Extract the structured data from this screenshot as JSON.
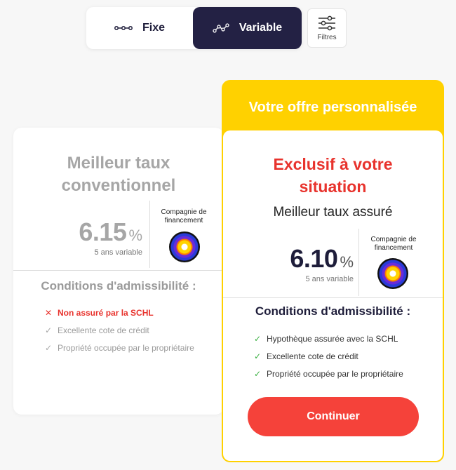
{
  "toggle": {
    "fixed_label": "Fixe",
    "variable_label": "Variable",
    "selected": "Variable"
  },
  "filters": {
    "label": "Filtres"
  },
  "conventional": {
    "title_line1": "Meilleur taux",
    "title_line2": "conventionnel",
    "rate": "6.15",
    "percent": "%",
    "term": "5 ans variable",
    "lender_line1": "Compagnie de",
    "lender_line2": "financement",
    "conditions_title": "Conditions d'admissibilité :",
    "conditions": [
      {
        "text": "Non assuré par la SCHL",
        "status": "no"
      },
      {
        "text": "Excellente cote de crédit",
        "status": "yes"
      },
      {
        "text": "Propriété occupée par le propriétaire",
        "status": "yes"
      }
    ]
  },
  "personalized": {
    "banner": "Votre offre personnalisée",
    "headline_line1": "Exclusif à votre",
    "headline_line2": "situation",
    "subtitle": "Meilleur taux assuré",
    "rate": "6.10",
    "percent": "%",
    "term": "5 ans variable",
    "lender_line1": "Compagnie de",
    "lender_line2": "financement",
    "conditions_title": "Conditions d'admissibilité :",
    "conditions": [
      {
        "text": "Hypothèque assurée avec la SCHL",
        "status": "yes"
      },
      {
        "text": "Excellente cote de crédit",
        "status": "yes"
      },
      {
        "text": "Propriété occupée par le propriétaire",
        "status": "yes"
      }
    ],
    "cta_label": "Continuer"
  },
  "colors": {
    "navy": "#232144",
    "accent_red": "#f5423a",
    "banner_yellow": "#ffd100",
    "check_green": "#3cb043",
    "muted_grey": "#a6a6a6"
  },
  "icons": {
    "fixed": "fixed-rate-line-icon",
    "variable": "variable-rate-line-icon",
    "filters": "sliders-icon",
    "check": "check-icon",
    "cross": "x-icon",
    "lender": "lender-logo"
  }
}
